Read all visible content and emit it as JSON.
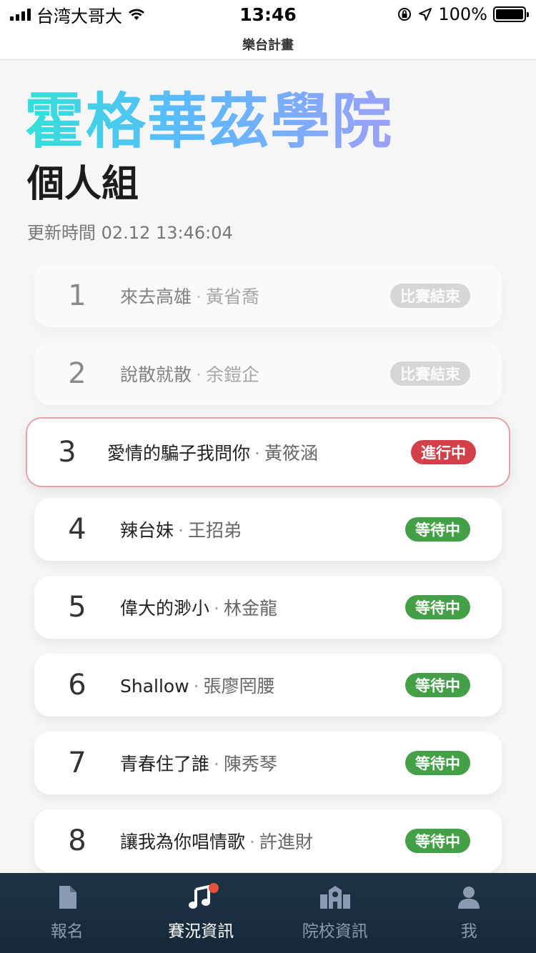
{
  "status": {
    "carrier": "台湾大哥大",
    "time": "13:46",
    "battery": "100%"
  },
  "nav": {
    "title": "樂台計畫"
  },
  "header": {
    "school": "霍格華茲學院",
    "group": "個人組",
    "update_time": "更新時間 02.12 13:46:04"
  },
  "songs": [
    {
      "num": "1",
      "title": "來去高雄",
      "singer": "黃省喬",
      "status": "比賽結束",
      "state": "done"
    },
    {
      "num": "2",
      "title": "說散就散",
      "singer": "余鎧企",
      "status": "比賽結束",
      "state": "done"
    },
    {
      "num": "3",
      "title": "愛情的騙子我問你",
      "singer": "黃筱涵",
      "status": "進行中",
      "state": "current"
    },
    {
      "num": "4",
      "title": "辣台妹",
      "singer": "王招弟",
      "status": "等待中",
      "state": "waiting"
    },
    {
      "num": "5",
      "title": "偉大的渺小",
      "singer": "林金龍",
      "status": "等待中",
      "state": "waiting"
    },
    {
      "num": "6",
      "title": "Shallow",
      "singer": "張廖罔腰",
      "status": "等待中",
      "state": "waiting"
    },
    {
      "num": "7",
      "title": "青春住了誰",
      "singer": "陳秀琴",
      "status": "等待中",
      "state": "waiting"
    },
    {
      "num": "8",
      "title": "讓我為你唱情歌",
      "singer": "許進財",
      "status": "等待中",
      "state": "waiting"
    }
  ],
  "separator": "·",
  "tabs": [
    {
      "label": "報名",
      "icon": "document-icon"
    },
    {
      "label": "賽況資訊",
      "icon": "music-note-icon"
    },
    {
      "label": "院校資訊",
      "icon": "school-icon"
    },
    {
      "label": "我",
      "icon": "person-icon"
    }
  ],
  "colors": {
    "waiting": "#43a047",
    "in_progress": "#d4404a",
    "finished": "#bdbdbd",
    "tab_bar": "#1d3346"
  }
}
